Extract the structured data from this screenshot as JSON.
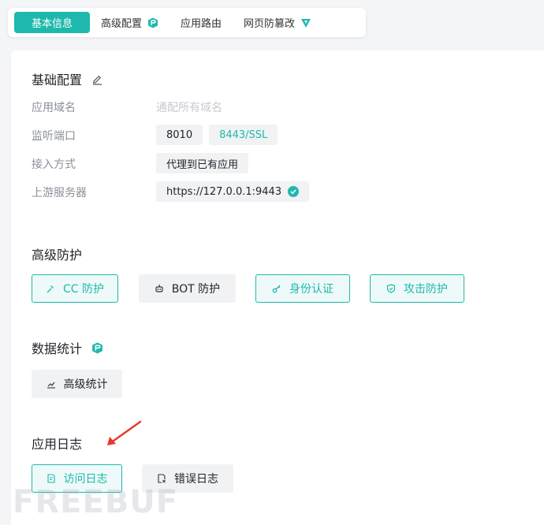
{
  "tabs": [
    {
      "label": "基本信息"
    },
    {
      "label": "高级配置"
    },
    {
      "label": "应用路由"
    },
    {
      "label": "网页防篡改"
    }
  ],
  "basic": {
    "title": "基础配置",
    "domain_label": "应用域名",
    "domain_value": "通配所有域名",
    "port_label": "监听端口",
    "ports": [
      "8010",
      "8443/SSL"
    ],
    "access_label": "接入方式",
    "access_value": "代理到已有应用",
    "upstream_label": "上游服务器",
    "upstream_value": "https://127.0.0.1:9443"
  },
  "protect": {
    "title": "高级防护",
    "buttons": [
      "CC 防护",
      "BOT 防护",
      "身份认证",
      "攻击防护"
    ]
  },
  "stats": {
    "title": "数据统计",
    "button": "高级统计"
  },
  "logs": {
    "title": "应用日志",
    "buttons": [
      "访问日志",
      "错误日志"
    ]
  },
  "watermark": "FREEBUF",
  "colors": {
    "accent": "#1fb8ad",
    "arrow": "#e8372c"
  }
}
